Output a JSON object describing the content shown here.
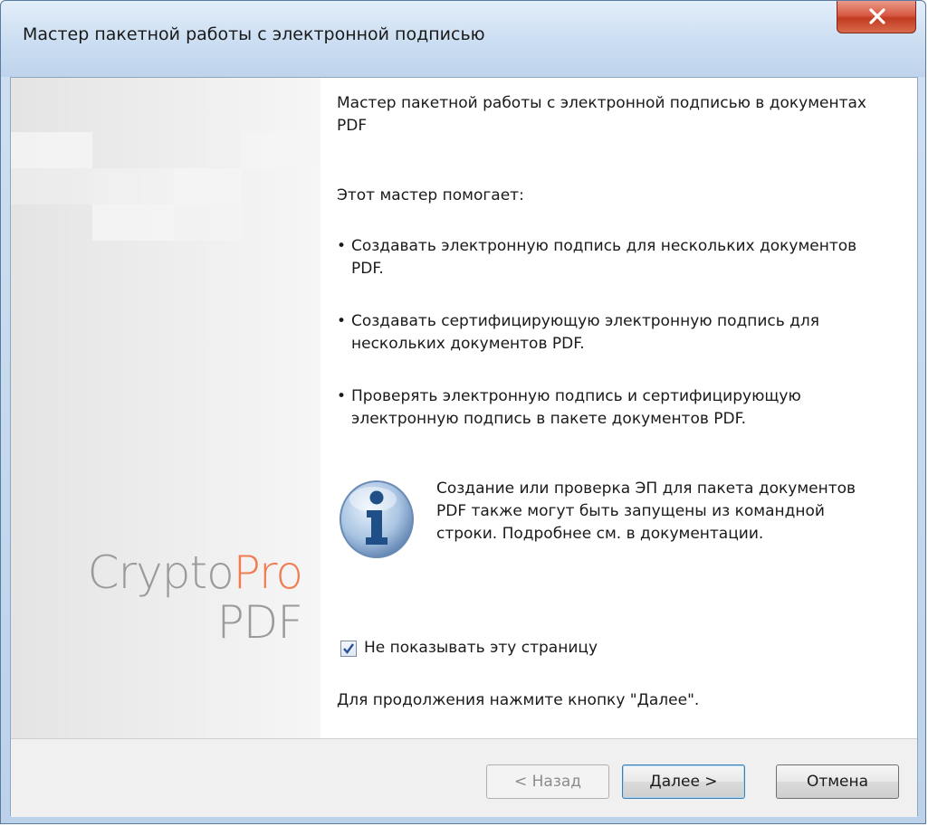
{
  "window": {
    "title": "Мастер пакетной работы с электронной подписью"
  },
  "banner": {
    "logo_crypto": "Crypto",
    "logo_pro": "Pro",
    "logo_pdf": "PDF",
    "logo_colors": {
      "gray": "#9a9a9a",
      "orange": "#f07c50"
    }
  },
  "content": {
    "heading": "Мастер пакетной работы с электронной подписью в документах PDF",
    "intro": "Этот мастер помогает:",
    "bullets": [
      "Создавать электронную подпись для нескольких документов PDF.",
      "Создавать сертифицирующую электронную подпись для нескольких документов PDF.",
      "Проверять электронную подпись и сертифицирующую электронную подпись в пакете документов PDF."
    ],
    "info_text": "Создание или проверка ЭП для пакета документов PDF также могут быть запущены из командной строки. Подробнее см. в документации.",
    "checkbox_label": "Не показывать эту страницу",
    "checkbox_checked": true,
    "continue_hint": "Для продолжения нажмите кнопку \"Далее\"."
  },
  "buttons": {
    "back": "< Назад",
    "next": "Далее >",
    "cancel": "Отмена"
  },
  "icons": {
    "close": "close-icon",
    "info": "info-icon",
    "check": "checkmark-icon"
  }
}
